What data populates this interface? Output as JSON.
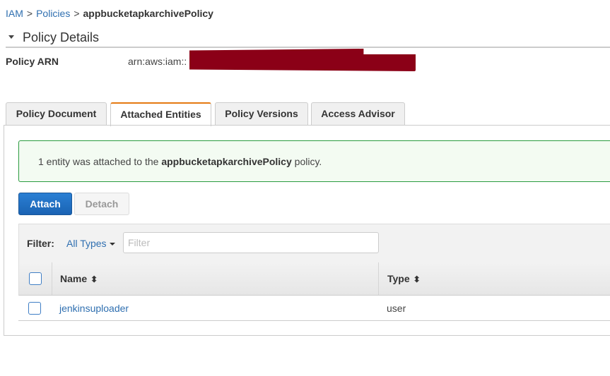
{
  "breadcrumb": {
    "items": [
      "IAM",
      "Policies"
    ],
    "separator": ">",
    "current": "appbucketapkarchivePolicy"
  },
  "section": {
    "title": "Policy Details",
    "caret_icon": "caret-down-icon"
  },
  "policy_arn": {
    "label": "Policy ARN",
    "value_prefix": "arn:aws:iam::",
    "redacted_color": "#8b0017"
  },
  "tabs": [
    {
      "label": "Policy Document",
      "active": false
    },
    {
      "label": "Attached Entities",
      "active": true
    },
    {
      "label": "Policy Versions",
      "active": false
    },
    {
      "label": "Access Advisor",
      "active": false
    }
  ],
  "message": {
    "prefix": "1 entity was attached to the ",
    "policy": "appbucketapkarchivePolicy",
    "suffix": " policy."
  },
  "buttons": {
    "attach": "Attach",
    "detach": "Detach"
  },
  "filter": {
    "label": "Filter:",
    "type_selected": "All Types",
    "placeholder": "Filter",
    "value": ""
  },
  "table": {
    "columns": [
      {
        "label": "Name",
        "sort_icon": "sort-icon"
      },
      {
        "label": "Type",
        "sort_icon": "sort-icon"
      }
    ],
    "rows": [
      {
        "name": "jenkinsuploader",
        "type": "user"
      }
    ]
  },
  "colors": {
    "link": "#2f6fb0",
    "active_tab_accent": "#e47911",
    "success_border": "#2a9b3f",
    "primary_button": "#1a63b3"
  }
}
